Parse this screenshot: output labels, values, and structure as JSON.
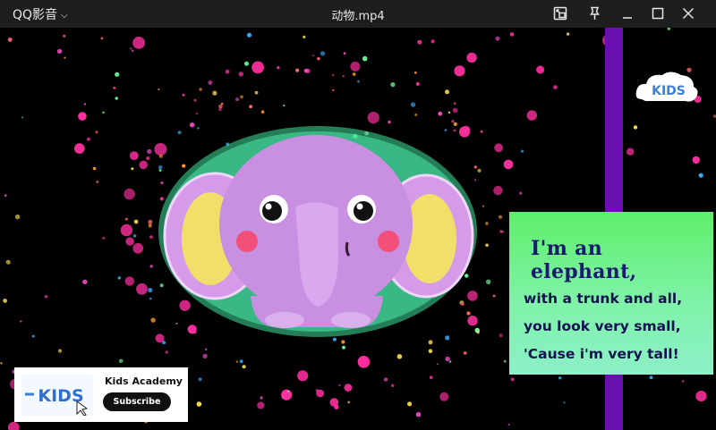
{
  "titlebar": {
    "app_name": "QQ影音",
    "file_title": "动物.mp4",
    "buttons": {
      "picture_in_picture": "picture-in-picture",
      "pin": "pin-on-top",
      "minimize": "minimize",
      "maximize": "maximize",
      "close": "close"
    }
  },
  "video": {
    "lyrics": {
      "line1": "I'm an elephant,",
      "line2": "with a trunk and all,",
      "line3": "you look very small,",
      "line4": "'Cause i'm very tall!"
    },
    "subscribe_card": {
      "channel_name": "Kids Academy",
      "button_label": "Subscribe",
      "logo_text": "KIDS"
    },
    "corner_logo_text": "KIDS",
    "colors": {
      "elephant_body": "#c98fe0",
      "elephant_ear_inner": "#f2df6a",
      "elephant_glow": "#3fe6a0",
      "lyrics_bg": "#6ff08a",
      "side_bar": "#6a0fb0"
    }
  }
}
